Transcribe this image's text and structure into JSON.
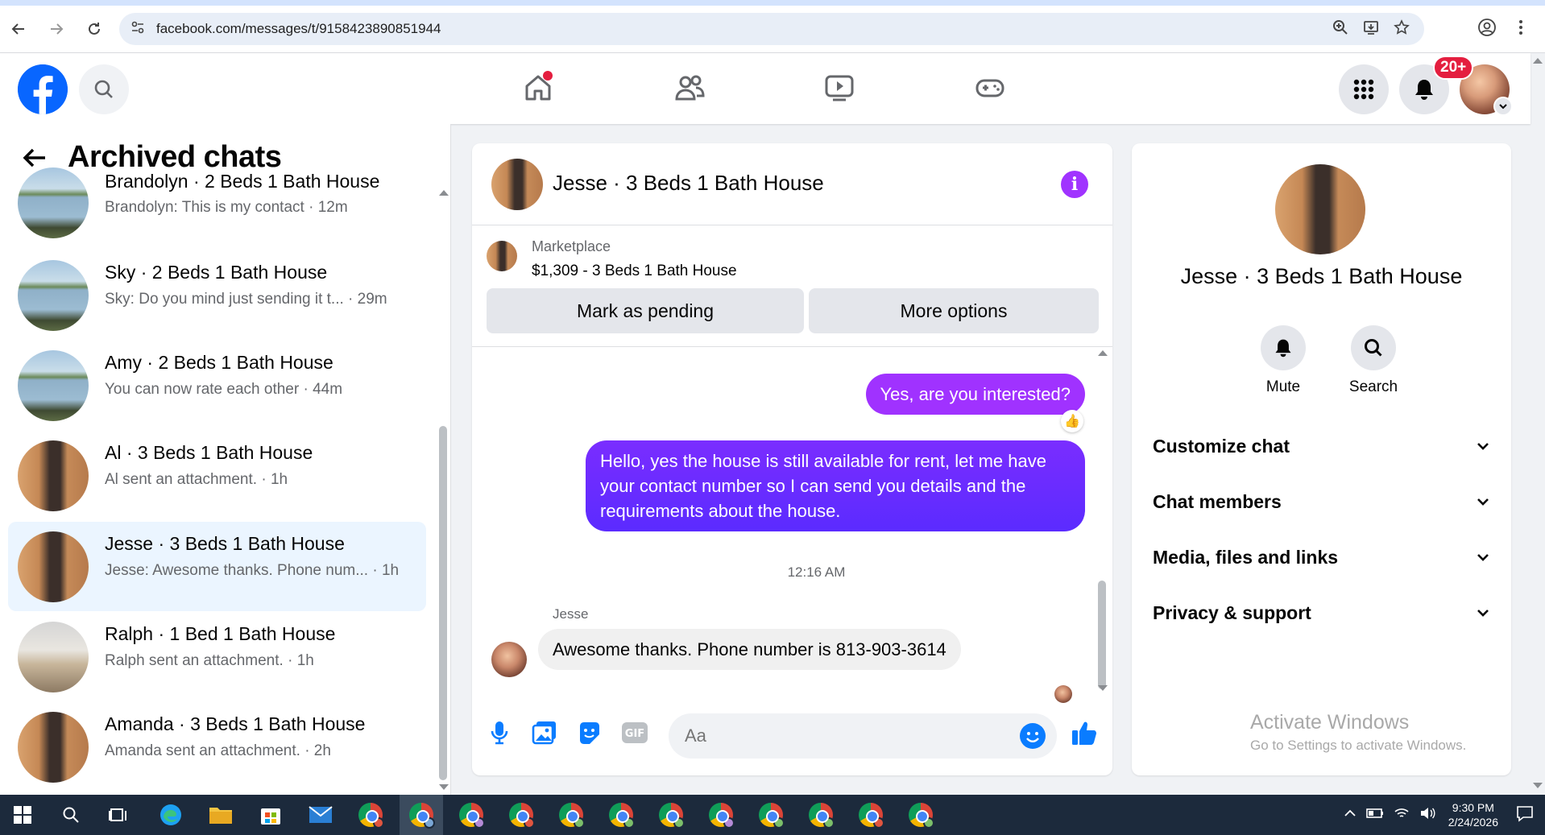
{
  "browser": {
    "url": "facebook.com/messages/t/9158423890851944"
  },
  "header": {
    "notification_badge": "20+"
  },
  "archived": {
    "title": "Archived chats",
    "chats": [
      {
        "name": "Brandolyn · 2 Beds 1 Bath House",
        "preview": "Brandolyn: This is my contact · 12m"
      },
      {
        "name": "Sky · 2 Beds 1 Bath House",
        "preview": "Sky: Do you mind just sending it t... · 29m"
      },
      {
        "name": "Amy · 2 Beds 1 Bath House",
        "preview": "You can now rate each other · 44m"
      },
      {
        "name": "Al · 3 Beds 1 Bath House",
        "preview": "Al sent an attachment. · 1h"
      },
      {
        "name": "Jesse · 3 Beds 1 Bath House",
        "preview": "Jesse: Awesome thanks. Phone num... · 1h"
      },
      {
        "name": "Ralph · 1 Bed 1 Bath House",
        "preview": "Ralph sent an attachment. · 1h"
      },
      {
        "name": "Amanda · 3 Beds 1 Bath House",
        "preview": "Amanda sent an attachment. · 2h"
      }
    ]
  },
  "conversation": {
    "title": "Jesse · 3 Beds 1 Bath House",
    "marketplace_label": "Marketplace",
    "listing": "$1,309 - 3 Beds 1 Bath House",
    "mark_pending": "Mark as pending",
    "more_options": "More options",
    "messages": {
      "out1": "Yes, are you interested?",
      "out2": "Hello, yes the house is still available for rent, let me have your contact number so I can send you details and the requirements about the house.",
      "timestamp": "12:16 AM",
      "sender": "Jesse",
      "in1": "Awesome thanks. Phone number is 813-903-3614"
    },
    "composer_placeholder": "Aa"
  },
  "details": {
    "name": "Jesse · 3 Beds 1 Bath House",
    "mute": "Mute",
    "search": "Search",
    "sections": [
      "Customize chat",
      "Chat members",
      "Media, files and links",
      "Privacy & support"
    ]
  },
  "watermark": {
    "line1": "Activate Windows",
    "line2": "Go to Settings to activate Windows."
  },
  "taskbar": {
    "time": "9:30 PM",
    "date": "2/24/2026"
  },
  "colors": {
    "accent": "#a033ff",
    "fb_blue": "#0866ff",
    "active_chat": "#ebf5ff"
  }
}
